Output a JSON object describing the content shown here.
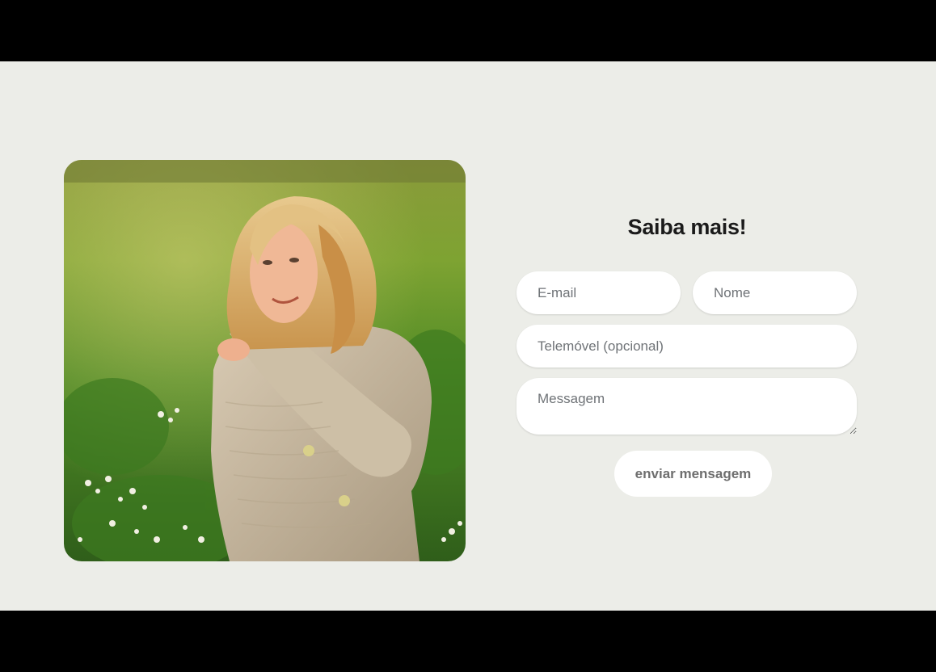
{
  "contact": {
    "title": "Saiba mais!",
    "email_placeholder": "E-mail",
    "name_placeholder": "Nome",
    "phone_placeholder": "Telemóvel (opcional)",
    "message_placeholder": "Messagem",
    "submit_label": "enviar mensagem"
  },
  "colors": {
    "background": "#ecede8",
    "field_background": "#ffffff",
    "title_text": "#1b1b1b",
    "button_text": "#6e6e6e"
  }
}
